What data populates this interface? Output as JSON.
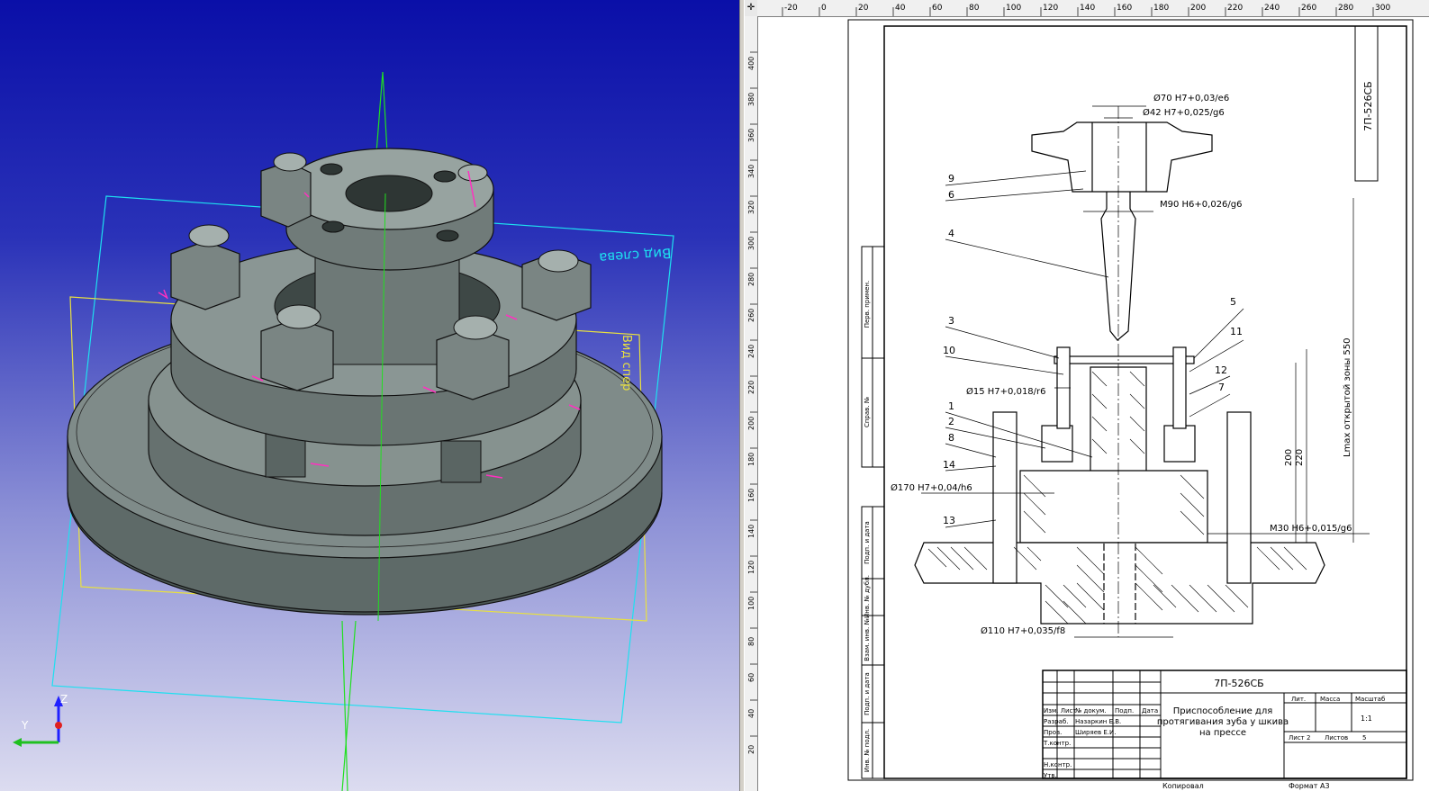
{
  "viewport3d": {
    "view_label_left": "Вид слева",
    "view_label_front": "Вид спер",
    "axis_z": "Z",
    "axis_y": "Y"
  },
  "drawing": {
    "ruler_top_ticks": [
      "-20",
      "0",
      "20",
      "40",
      "60",
      "80",
      "100",
      "120",
      "140",
      "160",
      "180",
      "200",
      "220",
      "240",
      "260",
      "280",
      "300"
    ],
    "ruler_left_ticks": [
      "400",
      "380",
      "360",
      "340",
      "320",
      "300",
      "280",
      "260",
      "240",
      "220",
      "200",
      "180",
      "160",
      "140",
      "120",
      "100",
      "80",
      "60",
      "40",
      "20"
    ],
    "vertical_code": "7П-526СБ",
    "dims": {
      "d70": "Ø70 H7+0,03/e6",
      "d42": "Ø42 H7+0,025/g6",
      "m90": "M90 H6+0,026/g6",
      "d15": "Ø15 H7+0,018/r6",
      "d170": "Ø170 H7+0,04/h6",
      "m30": "M30 H6+0,015/g6",
      "d110": "Ø110 H7+0,035/f8",
      "h200": "200",
      "h220": "220",
      "lmax": "Lmax открытой зоны 550"
    },
    "leaders": [
      "9",
      "6",
      "4",
      "3",
      "10",
      "1",
      "2",
      "8",
      "14",
      "13",
      "5",
      "11",
      "12",
      "7"
    ],
    "side_labels": [
      "Перв. примен.",
      "Справ. №",
      "Подп. и дата",
      "Инв. № дубл.",
      "Взам. инв. №",
      "Подп. и дата",
      "Инв. № подл."
    ],
    "title_block": {
      "code": "7П-526СБ",
      "name_line1": "Приспособление для",
      "name_line2": "протягивания зуба у шкива",
      "name_line3": "на прессе",
      "col_lit": "Лит.",
      "col_mass": "Масса",
      "col_scale": "Масштаб",
      "scale_value": "1:1",
      "sheet_label": "Лист",
      "sheet_value": "2",
      "sheets_label": "Листов",
      "sheets_value": "5",
      "row_izm": "Изм. Лист",
      "row_doc": "№ докум.",
      "row_sign": "Подп.",
      "row_date": "Дата",
      "razrab": "Разраб.",
      "razrab_name": "Назаркин Е.В.",
      "prov": "Пров.",
      "prov_name": "Шиpяев Е.И.",
      "tkontr": "Т.контр.",
      "nkontr": "Н.контр.",
      "utv": "Утв.",
      "kopiroval": "Копировал",
      "format": "Формат А3"
    }
  }
}
